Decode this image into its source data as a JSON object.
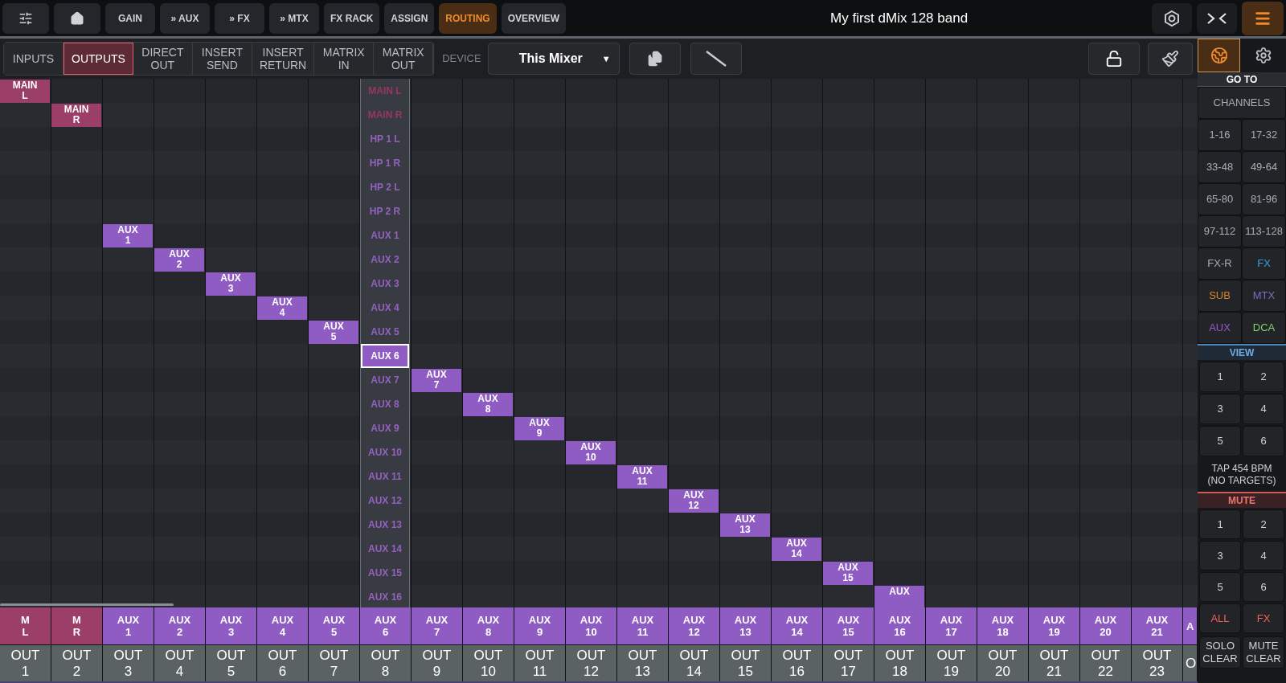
{
  "top_bar": {
    "nav": [
      {
        "kind": "icon",
        "selected": false
      },
      {
        "kind": "icon",
        "selected": false
      },
      {
        "kind": "text",
        "label": "GAIN",
        "selected": false
      },
      {
        "kind": "text",
        "label": "» AUX",
        "selected": false
      },
      {
        "kind": "text",
        "label": "» FX",
        "selected": false
      },
      {
        "kind": "text",
        "label": "» MTX",
        "selected": false
      },
      {
        "kind": "text",
        "label": "FX RACK",
        "selected": false
      },
      {
        "kind": "text",
        "label": "ASSIGN",
        "selected": false
      },
      {
        "kind": "text",
        "label": "ROUTING",
        "selected": true
      },
      {
        "kind": "text",
        "label": "OVERVIEW",
        "selected": false
      }
    ],
    "title": "My first dMix 128 band"
  },
  "toolbar": {
    "tabs": [
      {
        "line1": "INPUTS",
        "selected": false
      },
      {
        "line1": "OUTPUTS",
        "selected": true
      },
      {
        "line1": "DIRECT",
        "line2": "OUT",
        "selected": false
      },
      {
        "line1": "INSERT",
        "line2": "SEND",
        "selected": false
      },
      {
        "line1": "INSERT",
        "line2": "RETURN",
        "selected": false
      },
      {
        "line1": "MATRIX",
        "line2": "IN",
        "selected": false
      },
      {
        "line1": "MATRIX",
        "line2": "OUT",
        "selected": false
      }
    ],
    "device_label": "DEVICE",
    "device": {
      "value": "This Mixer",
      "arrow": "▼"
    }
  },
  "sources": [
    {
      "label": "MAIN L",
      "kind": "main",
      "selected": false,
      "patch": {
        "line1": "MAIN",
        "line2": "L"
      }
    },
    {
      "label": "MAIN R",
      "kind": "main",
      "selected": false,
      "patch": {
        "line1": "MAIN",
        "line2": "R"
      }
    },
    {
      "label": "HP 1 L",
      "kind": "aux",
      "selected": false
    },
    {
      "label": "HP 1 R",
      "kind": "aux",
      "selected": false
    },
    {
      "label": "HP 2 L",
      "kind": "aux",
      "selected": false
    },
    {
      "label": "HP 2 R",
      "kind": "aux",
      "selected": false
    },
    {
      "label": "AUX 1",
      "kind": "aux",
      "selected": false,
      "patch": {
        "line1": "AUX",
        "line2": "1"
      }
    },
    {
      "label": "AUX 2",
      "kind": "aux",
      "selected": false,
      "patch": {
        "line1": "AUX",
        "line2": "2"
      }
    },
    {
      "label": "AUX 3",
      "kind": "aux",
      "selected": false,
      "patch": {
        "line1": "AUX",
        "line2": "3"
      }
    },
    {
      "label": "AUX 4",
      "kind": "aux",
      "selected": false,
      "patch": {
        "line1": "AUX",
        "line2": "4"
      }
    },
    {
      "label": "AUX 5",
      "kind": "aux",
      "selected": false,
      "patch": {
        "line1": "AUX",
        "line2": "5"
      }
    },
    {
      "label": "AUX 6",
      "kind": "aux",
      "selected": true
    },
    {
      "label": "AUX 7",
      "kind": "aux",
      "selected": false,
      "patch": {
        "line1": "AUX",
        "line2": "7"
      }
    },
    {
      "label": "AUX 8",
      "kind": "aux",
      "selected": false,
      "patch": {
        "line1": "AUX",
        "line2": "8"
      }
    },
    {
      "label": "AUX 9",
      "kind": "aux",
      "selected": false,
      "patch": {
        "line1": "AUX",
        "line2": "9"
      }
    },
    {
      "label": "AUX 10",
      "kind": "aux",
      "selected": false,
      "patch": {
        "line1": "AUX",
        "line2": "10"
      }
    },
    {
      "label": "AUX 11",
      "kind": "aux",
      "selected": false,
      "patch": {
        "line1": "AUX",
        "line2": "11"
      }
    },
    {
      "label": "AUX 12",
      "kind": "aux",
      "selected": false,
      "patch": {
        "line1": "AUX",
        "line2": "12"
      }
    },
    {
      "label": "AUX 13",
      "kind": "aux",
      "selected": false,
      "patch": {
        "line1": "AUX",
        "line2": "13"
      }
    },
    {
      "label": "AUX 14",
      "kind": "aux",
      "selected": false,
      "patch": {
        "line1": "AUX",
        "line2": "14"
      }
    },
    {
      "label": "AUX 15",
      "kind": "aux",
      "selected": false,
      "patch": {
        "line1": "AUX",
        "line2": "15"
      }
    },
    {
      "label": "AUX 16",
      "kind": "aux",
      "selected": false,
      "patch": {
        "line1": "AUX"
      }
    }
  ],
  "outputs": [
    {
      "src1": "M",
      "src2": "L",
      "kind": "main",
      "out1": "OUT",
      "out2": "1",
      "picker_open": false
    },
    {
      "src1": "M",
      "src2": "R",
      "kind": "main",
      "out1": "OUT",
      "out2": "2",
      "picker_open": false
    },
    {
      "src1": "AUX",
      "src2": "1",
      "kind": "aux",
      "out1": "OUT",
      "out2": "3",
      "picker_open": false
    },
    {
      "src1": "AUX",
      "src2": "2",
      "kind": "aux",
      "out1": "OUT",
      "out2": "4",
      "picker_open": false
    },
    {
      "src1": "AUX",
      "src2": "3",
      "kind": "aux",
      "out1": "OUT",
      "out2": "5",
      "picker_open": false
    },
    {
      "src1": "AUX",
      "src2": "4",
      "kind": "aux",
      "out1": "OUT",
      "out2": "6",
      "picker_open": false
    },
    {
      "src1": "AUX",
      "src2": "5",
      "kind": "aux",
      "out1": "OUT",
      "out2": "7",
      "picker_open": false
    },
    {
      "src1": "AUX",
      "src2": "6",
      "kind": "aux",
      "out1": "OUT",
      "out2": "8",
      "picker_open": true
    },
    {
      "src1": "AUX",
      "src2": "7",
      "kind": "aux",
      "out1": "OUT",
      "out2": "9",
      "picker_open": false
    },
    {
      "src1": "AUX",
      "src2": "8",
      "kind": "aux",
      "out1": "OUT",
      "out2": "10",
      "picker_open": false
    },
    {
      "src1": "AUX",
      "src2": "9",
      "kind": "aux",
      "out1": "OUT",
      "out2": "11",
      "picker_open": false
    },
    {
      "src1": "AUX",
      "src2": "10",
      "kind": "aux",
      "out1": "OUT",
      "out2": "12",
      "picker_open": false
    },
    {
      "src1": "AUX",
      "src2": "11",
      "kind": "aux",
      "out1": "OUT",
      "out2": "13",
      "picker_open": false
    },
    {
      "src1": "AUX",
      "src2": "12",
      "kind": "aux",
      "out1": "OUT",
      "out2": "14",
      "picker_open": false
    },
    {
      "src1": "AUX",
      "src2": "13",
      "kind": "aux",
      "out1": "OUT",
      "out2": "15",
      "picker_open": false
    },
    {
      "src1": "AUX",
      "src2": "14",
      "kind": "aux",
      "out1": "OUT",
      "out2": "16",
      "picker_open": false
    },
    {
      "src1": "AUX",
      "src2": "15",
      "kind": "aux",
      "out1": "OUT",
      "out2": "17",
      "picker_open": false
    },
    {
      "src1": "AUX",
      "src2": "16",
      "kind": "aux",
      "out1": "OUT",
      "out2": "18",
      "picker_open": false
    },
    {
      "src1": "AUX",
      "src2": "17",
      "kind": "aux",
      "out1": "OUT",
      "out2": "19",
      "picker_open": false
    },
    {
      "src1": "AUX",
      "src2": "18",
      "kind": "aux",
      "out1": "OUT",
      "out2": "20",
      "picker_open": false
    },
    {
      "src1": "AUX",
      "src2": "19",
      "kind": "aux",
      "out1": "OUT",
      "out2": "21",
      "picker_open": false
    },
    {
      "src1": "AUX",
      "src2": "20",
      "kind": "aux",
      "out1": "OUT",
      "out2": "22",
      "picker_open": false
    },
    {
      "src1": "AUX",
      "src2": "21",
      "kind": "aux",
      "out1": "OUT",
      "out2": "23",
      "picker_open": false
    },
    {
      "src1": "A",
      "kind": "aux",
      "out1": "O",
      "picker_open": false
    }
  ],
  "side_panel": {
    "goto_header": "GO TO",
    "channels": "CHANNELS",
    "goto": [
      {
        "label": "1-16",
        "color": "#a8adb5"
      },
      {
        "label": "17-32",
        "color": "#a8adb5"
      },
      {
        "label": "33-48",
        "color": "#a8adb5"
      },
      {
        "label": "49-64",
        "color": "#a8adb5"
      },
      {
        "label": "65-80",
        "color": "#a8adb5"
      },
      {
        "label": "81-96",
        "color": "#a8adb5"
      },
      {
        "label": "97-112",
        "color": "#a8adb5"
      },
      {
        "label": "113-128",
        "color": "#a8adb5"
      },
      {
        "label": "FX-R",
        "color": "#a8adb5"
      },
      {
        "label": "FX",
        "color": "#3d9be0"
      },
      {
        "label": "SUB",
        "color": "#d9862e"
      },
      {
        "label": "MTX",
        "color": "#7a6cc8"
      },
      {
        "label": "AUX",
        "color": "#9a5cc8"
      },
      {
        "label": "DCA",
        "color": "#7fd36b"
      }
    ],
    "view_header": "VIEW",
    "view": [
      "1",
      "2",
      "3",
      "4",
      "5",
      "6"
    ],
    "tap": {
      "line1": "TAP 454 BPM",
      "line2": "(NO TARGETS)"
    },
    "mute_header": "MUTE",
    "mute": [
      {
        "label": "1",
        "kind": "plain"
      },
      {
        "label": "2",
        "kind": "plain"
      },
      {
        "label": "3",
        "kind": "plain"
      },
      {
        "label": "4",
        "kind": "plain"
      },
      {
        "label": "5",
        "kind": "plain"
      },
      {
        "label": "6",
        "kind": "plain"
      },
      {
        "label": "ALL",
        "kind": "red"
      },
      {
        "label": "FX",
        "kind": "red"
      }
    ],
    "clear": [
      {
        "line1": "SOLO",
        "line2": "CLEAR"
      },
      {
        "line1": "MUTE",
        "line2": "CLEAR"
      }
    ]
  }
}
